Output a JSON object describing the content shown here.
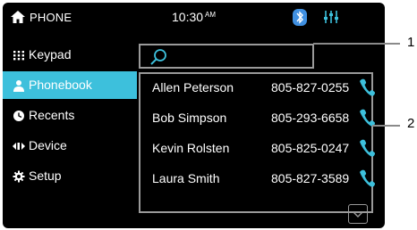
{
  "statusbar": {
    "title": "PHONE",
    "time": "10:30",
    "ampm": "AM"
  },
  "sidebar": {
    "items": [
      {
        "label": "Keypad",
        "icon": "keypad-icon"
      },
      {
        "label": "Phonebook",
        "icon": "person-icon",
        "active": true
      },
      {
        "label": "Recents",
        "icon": "recents-icon"
      },
      {
        "label": "Device",
        "icon": "device-icon"
      },
      {
        "label": "Setup",
        "icon": "gear-icon"
      }
    ]
  },
  "contacts": [
    {
      "name": "Allen Peterson",
      "number": "805-827-0255"
    },
    {
      "name": "Bob Simpson",
      "number": "805-293-6658"
    },
    {
      "name": "Kevin Rolsten",
      "number": "805-825-0247"
    },
    {
      "name": "Laura Smith",
      "number": "805-827-3589"
    }
  ],
  "callouts": {
    "search": "1",
    "list": "2"
  },
  "colors": {
    "accent": "#3dc0dc",
    "background": "#000000",
    "frame": "#9a9a9a"
  }
}
